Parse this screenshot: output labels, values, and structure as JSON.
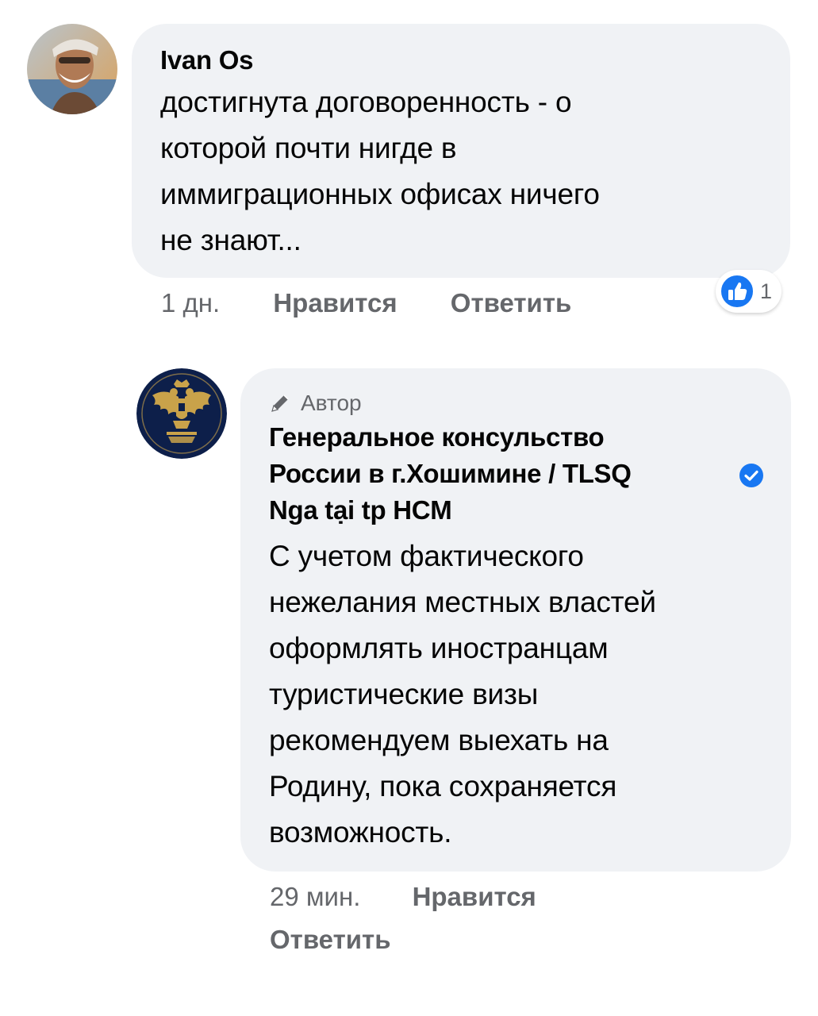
{
  "comments": [
    {
      "author": "Ivan Os",
      "text_lines": [
        "достигнута договоренность - о",
        "которой почти нигде в",
        "иммиграционных офисах ничего",
        "не знают..."
      ],
      "time": "1 дн.",
      "like_label": "Нравится",
      "reply_label": "Ответить",
      "reaction_count": "1",
      "reaction_icon": "like-thumb-icon"
    },
    {
      "badge_label": "Автор",
      "badge_icon": "pencil-icon",
      "author_lines": [
        "Генеральное консульство",
        "России в г.Хошимине / TLSQ",
        "Nga tại tp HCM"
      ],
      "verified_icon": "verified-check-icon",
      "text_lines": [
        "С учетом фактического",
        "нежелания местных властей",
        "оформлять иностранцам",
        "туристические визы",
        "рекомендуем выехать на",
        "Родину, пока сохраняется",
        "возможность."
      ],
      "time": "29 мин.",
      "like_label": "Нравится",
      "reply_label": "Ответить"
    }
  ],
  "colors": {
    "bubble_bg": "#f0f2f5",
    "secondary_text": "#65676b",
    "facebook_blue": "#1877f2",
    "emblem_navy": "#0d1f4a",
    "emblem_gold": "#c9a24a"
  }
}
